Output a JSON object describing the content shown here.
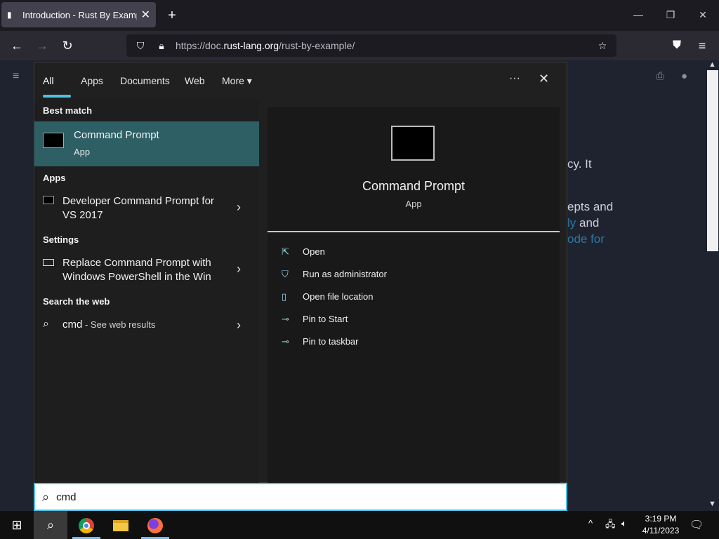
{
  "browser": {
    "tab_title": "Introduction - Rust By Example",
    "new_tab": "+",
    "url_prefix": "https://doc.",
    "url_domain": "rust-lang.org",
    "url_suffix": "/rust-by-example/",
    "window_min": "—",
    "window_restore": "❐",
    "window_close": "✕"
  },
  "page_behind": {
    "line1": "cy. It",
    "line2": "epts and",
    "line3_link": "ly",
    "line3_rest": " and",
    "line4_link": "ode for"
  },
  "start_menu": {
    "tabs": [
      "All",
      "Apps",
      "Documents",
      "Web",
      "More"
    ],
    "more_arrow": "▾",
    "dots": "···",
    "close": "✕",
    "best_match_heading": "Best match",
    "best_match": {
      "title": "Command Prompt",
      "subtitle": "App"
    },
    "apps_heading": "Apps",
    "apps": [
      {
        "title_line1": "Developer Command Prompt for",
        "title_line2": "VS 2017"
      }
    ],
    "settings_heading": "Settings",
    "settings": [
      {
        "title_line1": "Replace Command Prompt with",
        "title_line2": "Windows PowerShell in the Win"
      }
    ],
    "web_heading": "Search the web",
    "web": {
      "query": "cmd",
      "suffix": " - See web results"
    },
    "detail": {
      "title": "Command Prompt",
      "subtitle": "App"
    },
    "actions": [
      "Open",
      "Run as administrator",
      "Open file location",
      "Pin to Start",
      "Pin to taskbar"
    ]
  },
  "search_box": {
    "value": "cmd"
  },
  "taskbar": {
    "time": "3:19 PM",
    "date": "4/11/2023"
  },
  "colors": {
    "accent": "#4cc2e4",
    "best_match_bg": "#2d5f65"
  }
}
